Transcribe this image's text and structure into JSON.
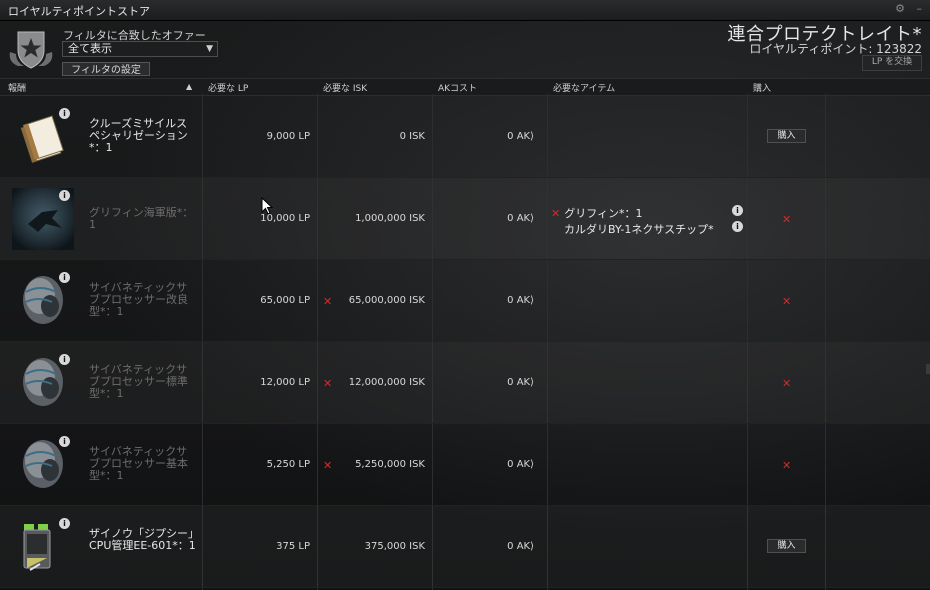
{
  "window": {
    "title": "ロイヤルティポイントストア",
    "controls": [
      "⚙",
      "–"
    ]
  },
  "filter": {
    "label": "フィルタに合致したオファー",
    "selected": "全て表示",
    "settings_button": "フィルタの設定"
  },
  "corp": {
    "name": "連合プロテクトレイト*",
    "points": "ロイヤルティポイント: 123822",
    "exchange_button": "LP を交換"
  },
  "table": {
    "headers": {
      "reward": "報酬",
      "lp": "必要な LP",
      "isk": "必要な ISK",
      "ak": "AKコスト",
      "items": "必要なアイテム",
      "buy": "購入"
    },
    "rows": [
      {
        "name": "クルーズミサイルスペシャリゼーション*：1",
        "lp": "9,000 LP",
        "isk": "0 ISK",
        "ak": "0 AK⟩",
        "buy": "購入",
        "icon": "skillbook-icon"
      },
      {
        "name": "グリフィン海軍版*：1",
        "lp": "10,000 LP",
        "isk": "1,000,000 ISK",
        "ak": "0 AK⟩",
        "required": [
          "グリフィン*：1",
          "カルダリBY-1ネクサスチップ*"
        ],
        "icon": "ship-icon"
      },
      {
        "name": "サイバネティックサブプロセッサー改良型*：1",
        "lp": "65,000 LP",
        "isk": "65,000,000 ISK",
        "ak": "0 AK⟩",
        "icon": "implant-head-icon"
      },
      {
        "name": "サイバネティックサブプロセッサー標準型*：1",
        "lp": "12,000 LP",
        "isk": "12,000,000 ISK",
        "ak": "0 AK⟩",
        "icon": "implant-head-icon"
      },
      {
        "name": "サイバネティックサブプロセッサー基本型*：1",
        "lp": "5,250 LP",
        "isk": "5,250,000 ISK",
        "ak": "0 AK⟩",
        "icon": "implant-head-icon"
      },
      {
        "name": "ザイノウ「ジプシー」CPU管理EE-601*：1",
        "lp": "375 LP",
        "isk": "375,000 ISK",
        "ak": "0 AK⟩",
        "buy": "購入",
        "icon": "cpu-module-icon"
      }
    ]
  },
  "colors": {
    "background": "#141516",
    "error_red": "#d42a2a",
    "text": "#e8e8e8"
  }
}
